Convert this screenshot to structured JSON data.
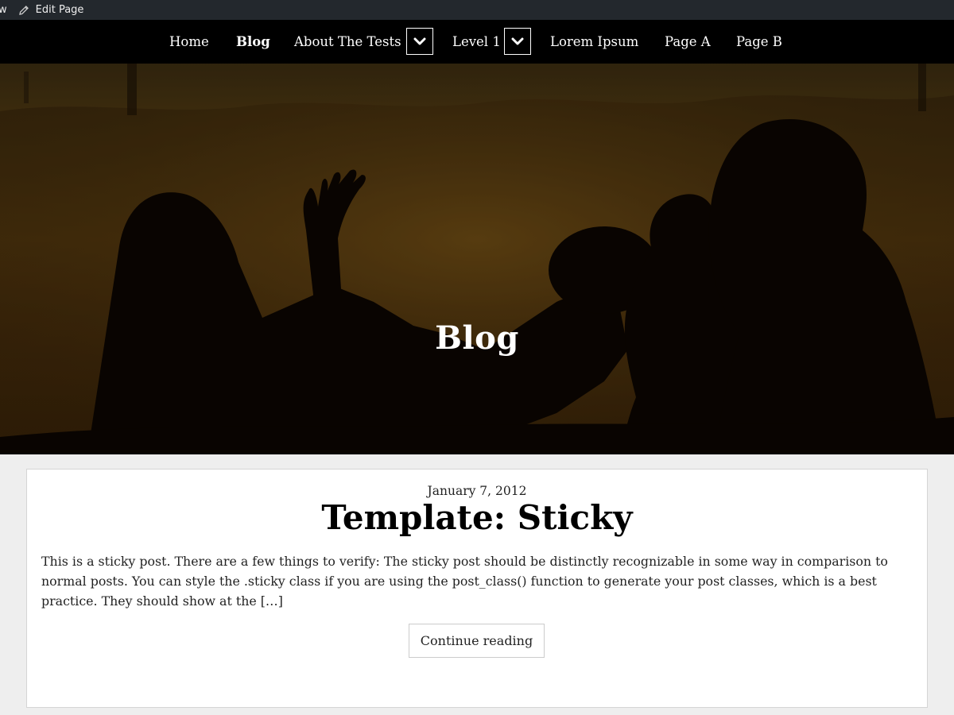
{
  "admin_bar": {
    "truncated_label": "w",
    "edit_page_label": "Edit Page"
  },
  "nav": {
    "items": [
      {
        "label": "Home"
      },
      {
        "label": "Blog"
      },
      {
        "label": "About The Tests"
      },
      {
        "label": "Level 1"
      },
      {
        "label": "Lorem Ipsum"
      },
      {
        "label": "Page A"
      },
      {
        "label": "Page B"
      }
    ],
    "active": "Blog"
  },
  "hero": {
    "title": "Blog"
  },
  "post": {
    "date": "January 7, 2012",
    "title": "Template: Sticky",
    "excerpt": "This is a sticky post. There are a few things to verify: The sticky post should be distinctly recognizable in some way in comparison to normal posts. You can style the .sticky class if you are using the post_class() function to generate your post classes, which is a best practice. They should show at the […]",
    "continue_label": "Continue reading"
  },
  "colors": {
    "admin_bar_bg": "#23282d",
    "nav_bg": "#000000",
    "page_bg": "#eeeeee",
    "card_bg": "#ffffff"
  }
}
